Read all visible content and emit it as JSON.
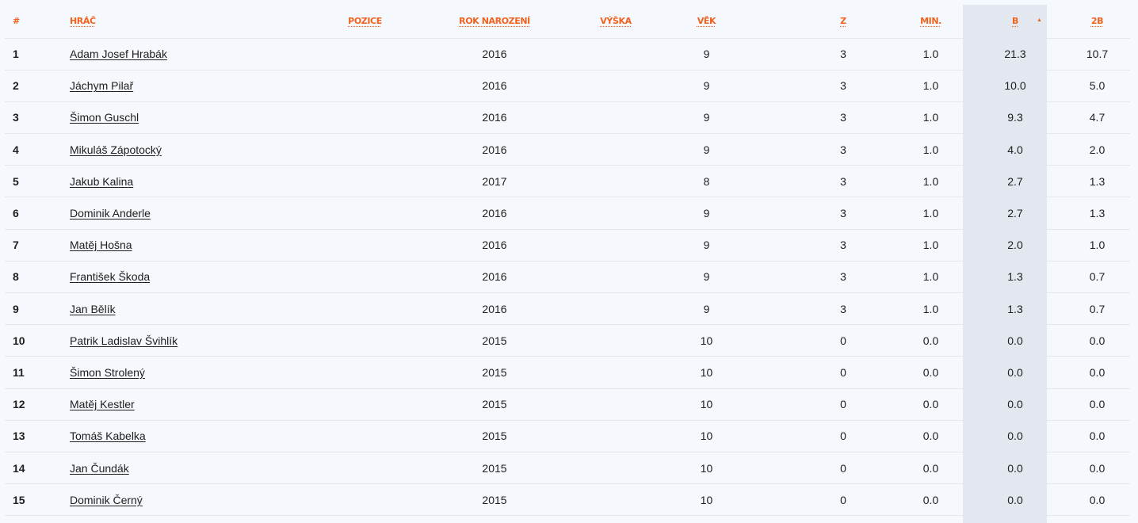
{
  "header": {
    "num": "#",
    "player": "HRÁČ",
    "position": "POZICE",
    "birth_year": "ROK NAROZENÍ",
    "height": "VÝŠKA",
    "age": "VĚK",
    "games": "Z",
    "minutes": "MIN.",
    "points": "B",
    "two_points": "2B",
    "sort_indicator": "▲"
  },
  "accent_color": "#f0621d",
  "sorted_column": "B",
  "rows": [
    {
      "rank": "1",
      "name": "Adam Josef Hrabák",
      "position": "",
      "birth_year": "2016",
      "height": "",
      "age": "9",
      "games": "3",
      "minutes": "1.0",
      "points": "21.3",
      "two_points": "10.7"
    },
    {
      "rank": "2",
      "name": "Jáchym Pilař",
      "position": "",
      "birth_year": "2016",
      "height": "",
      "age": "9",
      "games": "3",
      "minutes": "1.0",
      "points": "10.0",
      "two_points": "5.0"
    },
    {
      "rank": "3",
      "name": "Šimon Guschl",
      "position": "",
      "birth_year": "2016",
      "height": "",
      "age": "9",
      "games": "3",
      "minutes": "1.0",
      "points": "9.3",
      "two_points": "4.7"
    },
    {
      "rank": "4",
      "name": "Mikuláš Zápotocký",
      "position": "",
      "birth_year": "2016",
      "height": "",
      "age": "9",
      "games": "3",
      "minutes": "1.0",
      "points": "4.0",
      "two_points": "2.0"
    },
    {
      "rank": "5",
      "name": "Jakub Kalina",
      "position": "",
      "birth_year": "2017",
      "height": "",
      "age": "8",
      "games": "3",
      "minutes": "1.0",
      "points": "2.7",
      "two_points": "1.3"
    },
    {
      "rank": "6",
      "name": "Dominik Anderle",
      "position": "",
      "birth_year": "2016",
      "height": "",
      "age": "9",
      "games": "3",
      "minutes": "1.0",
      "points": "2.7",
      "two_points": "1.3"
    },
    {
      "rank": "7",
      "name": "Matěj Hošna",
      "position": "",
      "birth_year": "2016",
      "height": "",
      "age": "9",
      "games": "3",
      "minutes": "1.0",
      "points": "2.0",
      "two_points": "1.0"
    },
    {
      "rank": "8",
      "name": "František Škoda",
      "position": "",
      "birth_year": "2016",
      "height": "",
      "age": "9",
      "games": "3",
      "minutes": "1.0",
      "points": "1.3",
      "two_points": "0.7"
    },
    {
      "rank": "9",
      "name": "Jan Bělík",
      "position": "",
      "birth_year": "2016",
      "height": "",
      "age": "9",
      "games": "3",
      "minutes": "1.0",
      "points": "1.3",
      "two_points": "0.7"
    },
    {
      "rank": "10",
      "name": "Patrik Ladislav Švihlík",
      "position": "",
      "birth_year": "2015",
      "height": "",
      "age": "10",
      "games": "0",
      "minutes": "0.0",
      "points": "0.0",
      "two_points": "0.0"
    },
    {
      "rank": "11",
      "name": "Šimon Strolený",
      "position": "",
      "birth_year": "2015",
      "height": "",
      "age": "10",
      "games": "0",
      "minutes": "0.0",
      "points": "0.0",
      "two_points": "0.0"
    },
    {
      "rank": "12",
      "name": "Matěj Kestler",
      "position": "",
      "birth_year": "2015",
      "height": "",
      "age": "10",
      "games": "0",
      "minutes": "0.0",
      "points": "0.0",
      "two_points": "0.0"
    },
    {
      "rank": "13",
      "name": "Tomáš Kabelka",
      "position": "",
      "birth_year": "2015",
      "height": "",
      "age": "10",
      "games": "0",
      "minutes": "0.0",
      "points": "0.0",
      "two_points": "0.0"
    },
    {
      "rank": "14",
      "name": "Jan Čundák",
      "position": "",
      "birth_year": "2015",
      "height": "",
      "age": "10",
      "games": "0",
      "minutes": "0.0",
      "points": "0.0",
      "two_points": "0.0"
    },
    {
      "rank": "15",
      "name": "Dominik Černý",
      "position": "",
      "birth_year": "2015",
      "height": "",
      "age": "10",
      "games": "0",
      "minutes": "0.0",
      "points": "0.0",
      "two_points": "0.0"
    }
  ]
}
